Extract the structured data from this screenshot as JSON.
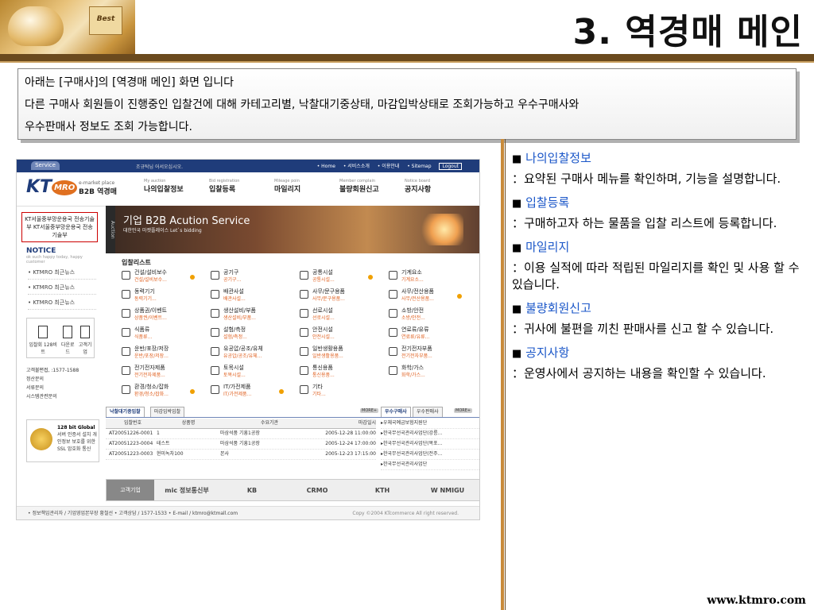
{
  "slide": {
    "title": "3. 역경매 메인",
    "badge": "Best",
    "footer_url": "www.ktmro.com"
  },
  "description": {
    "line1": "아래는 [구매사]의 [역경매 메인] 화면 입니다",
    "line2": "다른 구매사 회원들이 진행중인 입찰건에 대해 카테고리별, 낙찰대기중상태, 마감입박상태로 조회가능하고 우수구매사와",
    "line3": "우수판매사  정보도 조회 가능합니다."
  },
  "items": [
    {
      "marker": "■",
      "title": "나의입찰정보",
      "desc": "：요약된 구매사 메뉴를 확인하며, 기능을 설명합니다."
    },
    {
      "marker": "■",
      "title": "입찰등록",
      "desc": "：구매하고자 하는 물품을 입찰 리스트에 등록합니다."
    },
    {
      "marker": "■",
      "title": "마일리지",
      "desc": "：이용 실적에 따라 적립된 마일리지를 확인 및 사용 할 수 있습니다."
    },
    {
      "marker": "■",
      "title": "불량회원신고",
      "desc": "：귀사에 불편을 끼친 판매사를 신고 할 수 있습니다."
    },
    {
      "marker": "■",
      "title": "공지사항",
      "desc": "：운영사에서 공지하는 내용을 확인할 수 있습니다."
    }
  ],
  "shot": {
    "service_tab": "Service",
    "greeting": "조규탁님 어서오십시오.",
    "top_links": [
      "• Home",
      "• 서비스소개",
      "• 이용안내",
      "• Sitemap"
    ],
    "logout": "Logout",
    "logo_kt": "KT",
    "logo_mro": "MRO",
    "logo_sub": "e-market place",
    "logo_name": "B2B 역경매",
    "menu": [
      {
        "en": "My auction",
        "ko": "나의입찰정보"
      },
      {
        "en": "Bid registration",
        "ko": "입찰등록"
      },
      {
        "en": "Mileage poin",
        "ko": "마일리지"
      },
      {
        "en": "Member complain",
        "ko": "불량회원신고"
      },
      {
        "en": "Notice board",
        "ko": "공지사항"
      }
    ],
    "side_box": "KT서울중부망운용국 전송기술부 KT서울중부망운용국 전송기술부",
    "notice_title": "NOTICE",
    "notice_sub": "ok such happy today, happy customer",
    "notice_items": [
      "• KTMRO 최근뉴스",
      "• KTMRO 최근뉴스",
      "• KTMRO 최근뉴스"
    ],
    "quick": [
      "입찰회 128비트",
      "다운로드",
      "고객기업"
    ],
    "cs_lines": [
      "고객불편접, :1577-1588",
      "정산문의",
      "서류문의",
      "시스템관련문의"
    ],
    "glob_title": "128 bit Global",
    "glob_sub": "서버 인증서 설치 개인정보 보호를 위한 SSL 암호화 통신",
    "banner_tab": "Auction",
    "banner_title": "기업 B2B Acution Service",
    "banner_sub": "대한민국 마켓플레이스 Let`s bidding",
    "cats_title": "입찰리스트",
    "cats": [
      {
        "t": "건설/설비보수",
        "s": "건설/설비보수..."
      },
      {
        "t": "공기구",
        "s": "공기구..."
      },
      {
        "t": "공통시설",
        "s": "공통시설..."
      },
      {
        "t": "기계요소",
        "s": "기계요소..."
      },
      {
        "t": "동력기기",
        "s": "동력기기..."
      },
      {
        "t": "배관사설",
        "s": "배관사설..."
      },
      {
        "t": "사무/문구용품",
        "s": "사무/문구용품..."
      },
      {
        "t": "사무/전산용품",
        "s": "사무/전산용품..."
      },
      {
        "t": "상품권/이벤트",
        "s": "상품권/이벤트..."
      },
      {
        "t": "생산설비/부품",
        "s": "생산설비/부품..."
      },
      {
        "t": "선로시설",
        "s": "선로시설..."
      },
      {
        "t": "소방/안전",
        "s": "소방/안전..."
      },
      {
        "t": "식품류",
        "s": "식품류..."
      },
      {
        "t": "설험/측정",
        "s": "설험/측정..."
      },
      {
        "t": "안전시설",
        "s": "안전시설..."
      },
      {
        "t": "연료류/유류",
        "s": "연료류/유류..."
      },
      {
        "t": "운반/포장/저장",
        "s": "운반/포장/저장..."
      },
      {
        "t": "유공압/공조/유체",
        "s": "유공압/공조/유체..."
      },
      {
        "t": "일반생활용품",
        "s": "일반생활용품..."
      },
      {
        "t": "전기전자부품",
        "s": "전기전자부품..."
      },
      {
        "t": "전기전자제품",
        "s": "전기전자제품..."
      },
      {
        "t": "토목시설",
        "s": "토목시설..."
      },
      {
        "t": "통신용품",
        "s": "통신용품..."
      },
      {
        "t": "화학/가스",
        "s": "화학/가스..."
      },
      {
        "t": "환경/청소/잡화",
        "s": "환경/청소/잡화..."
      },
      {
        "t": "IT/가전제품",
        "s": "IT/가전제품..."
      },
      {
        "t": "기타",
        "s": "기타..."
      }
    ],
    "tabs_left": [
      "낙찰대기중입찰",
      "마감임박입찰"
    ],
    "tabs_right": [
      "우수구매사",
      "우수판매사"
    ],
    "more": "MORE+",
    "table_head": [
      "입찰번호",
      "상품명",
      "수요기관",
      "마감일시"
    ],
    "table_rows": [
      [
        "AT20051226-0001",
        "1",
        "마삼석품 기흥1공장",
        "2005-12-28 11:00:00"
      ],
      [
        "AT20051223-0004",
        "테스트",
        "마삼석품 기흥1공장",
        "2005-12-24 17:00:00"
      ],
      [
        "AT20051223-0003",
        "현미녹차100",
        "본사",
        "2005-12-23 17:15:00"
      ]
    ],
    "best_list": [
      "▸우체국예금보험지원단",
      "▸한국무선국관리사업단(강릉...",
      "▸한국무선국관리사업단(목포...",
      "▸한국무선국관리사업단(전주...",
      "▸한국무선국관리사업단"
    ],
    "partners_label": "고객기업",
    "partners": [
      "mic 정보통신부",
      "KB",
      "CRMO",
      "KTH",
      "W NMIGU"
    ],
    "footer_left": "• 정보책임관리자 / 기업영업본부장 황철선 • 고객상담 / 1577-1533 • E-mail / ktmro@ktmall.com",
    "footer_right": "Copy ©2004 KTcommerce All right reserved."
  }
}
